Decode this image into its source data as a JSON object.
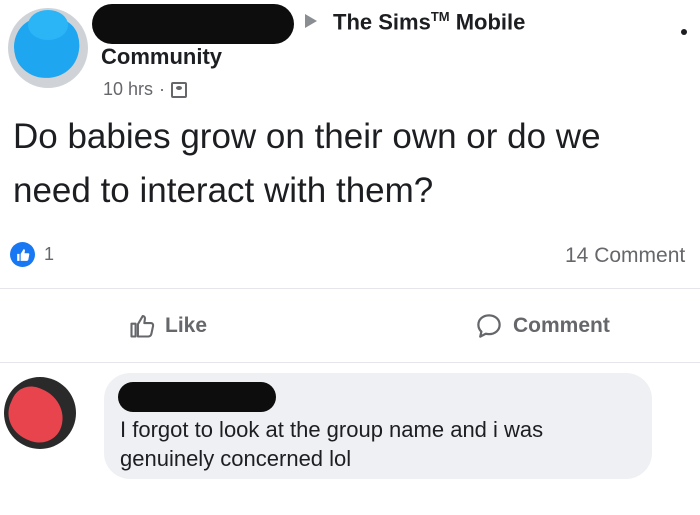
{
  "post": {
    "group_name": "The Sims",
    "group_tm": "TM",
    "group_name_suffix": "Mobile",
    "group_type": "Community",
    "time": "10 hrs",
    "meta_sep": "·",
    "text_line1": "Do babies grow on their own or do we",
    "text_line2": "need to interact with them?",
    "reaction_count": "1",
    "comments_label": "14 Comment"
  },
  "actions": {
    "like_label": "Like",
    "comment_label": "Comment"
  },
  "comment": {
    "text_line1": "I forgot to look at the group name and i was",
    "text_line2": "genuinely concerned lol"
  },
  "colors": {
    "facebook_blue": "#1877f2",
    "muted_text": "#65676b",
    "bubble_bg": "#eef0f3"
  },
  "icons": {
    "like": "thumbs-up-icon",
    "comment": "speech-bubble-icon",
    "group": "group-icon",
    "arrow": "right-arrow-icon"
  }
}
